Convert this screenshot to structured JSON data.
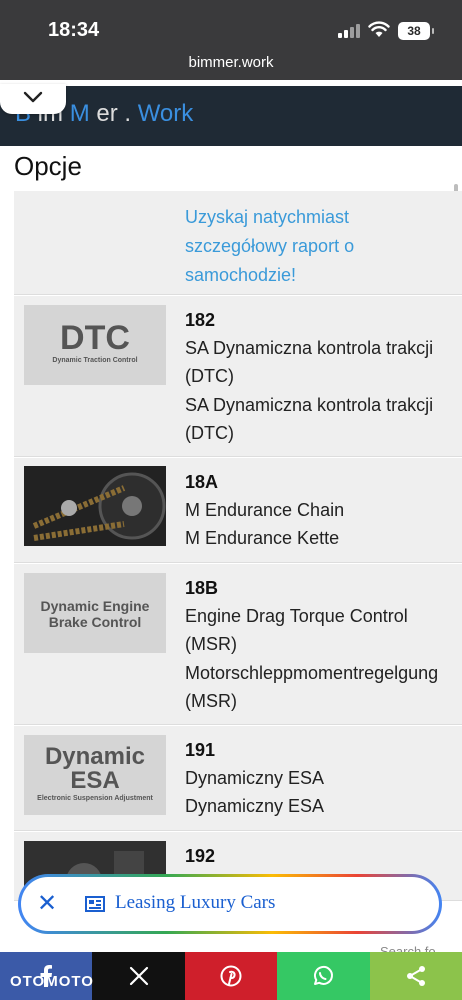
{
  "status_bar": {
    "time": "18:34",
    "battery": "38",
    "url": "bimmer.work"
  },
  "header": {
    "logo_parts": [
      "B",
      " im ",
      "M",
      " er . ",
      "Work"
    ],
    "collapse_icon": "chevron-down-icon"
  },
  "section_title": "Opcje",
  "promo": {
    "lines": [
      "Uzyskaj natychmiast",
      "szczegółowy raport o",
      "samochodzie!"
    ]
  },
  "options": [
    {
      "code": "182",
      "thumb_title": "DTC",
      "thumb_subtitle": "Dynamic Traction Control",
      "lines": [
        "SA Dynamiczna kontrola trakcji",
        "(DTC)",
        "SA Dynamiczna kontrola trakcji",
        "(DTC)"
      ]
    },
    {
      "code": "18A",
      "thumb_title": "",
      "thumb_subtitle": "",
      "lines": [
        "M Endurance Chain",
        "M Endurance Kette"
      ]
    },
    {
      "code": "18B",
      "thumb_title": "Dynamic Engine",
      "thumb_title2": "Brake Control",
      "thumb_subtitle": "",
      "lines": [
        "Engine Drag Torque Control",
        "(MSR)",
        "Motorschleppmomentregelgung",
        "(MSR)"
      ]
    },
    {
      "code": "191",
      "thumb_title": "Dynamic",
      "thumb_title2": "ESA",
      "thumb_subtitle": "Electronic Suspension Adjustment",
      "lines": [
        "Dynamiczny ESA",
        "Dynamiczny ESA"
      ]
    },
    {
      "code": "192",
      "thumb_title": "",
      "thumb_subtitle": "",
      "lines": []
    }
  ],
  "leasing": {
    "label": "Leasing Luxury Cars",
    "close_icon": "close-icon",
    "icon": "newspaper-icon"
  },
  "search_hint": "Search fo",
  "share_bar": {
    "brand": "OTOMOTO",
    "buttons": [
      {
        "name": "facebook",
        "color": "#3b5aa8"
      },
      {
        "name": "x",
        "color": "#111111"
      },
      {
        "name": "pinterest",
        "color": "#cf1f2b"
      },
      {
        "name": "whatsapp",
        "color": "#35c864"
      },
      {
        "name": "share",
        "color": "#8cc34b"
      }
    ]
  }
}
